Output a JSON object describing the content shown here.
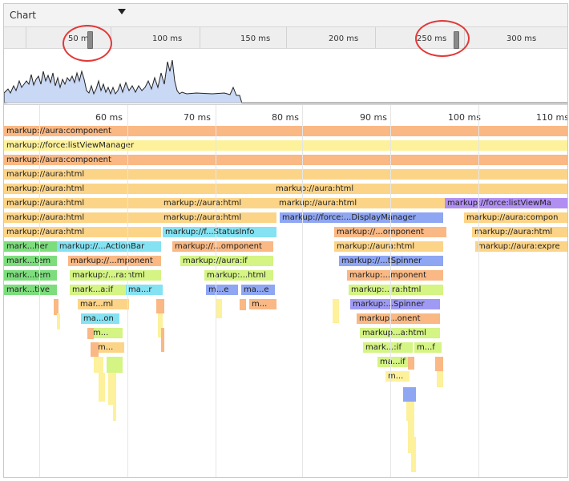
{
  "toolbar": {
    "select_label": "Chart",
    "caret_icon": "caret-down-icon"
  },
  "overview": {
    "ticks": [
      "50 ms",
      "100 ms",
      "150 ms",
      "200 ms",
      "250 ms",
      "300 ms"
    ],
    "left_handle_label": "50 m"
  },
  "main_ruler": {
    "ticks": [
      "60 ms",
      "70 ms",
      "80 ms",
      "90 ms",
      "100 ms",
      "110 ms"
    ]
  },
  "colors": {
    "orange": "#f9b884",
    "yellow": "#fdf19b",
    "gold": "#fcd488",
    "lime": "#d4f484",
    "green": "#7ddd7d",
    "cyan": "#84e2f2",
    "blue": "#8fa6f2",
    "periwinkle": "#9f9af4",
    "purple": "#b18ff2",
    "overview_fill": "#c9d8f4",
    "overview_line": "#222222",
    "annotation": "#e33838"
  },
  "flame": [
    "markup://aura:component",
    "markup://force:listViewManager",
    "markup://aura:component",
    "markup://aura:html",
    "markup://aura:html",
    "markup://aura:html",
    "markup://aura:html",
    "markup://aura:html",
    "markup://aura:html",
    "markup://aura:html",
    "markup://aura:html",
    "markup://aura:html",
    "markup://force:listViewMa",
    "markup://force:...DisplayManager",
    "markup://aura:compon",
    "markup://f...StatusInfo",
    "markup://...omponent",
    "markup://aura:html",
    "markup://aura:html",
    "mark...her",
    "markup://...ActionBar",
    "markup://...omponent",
    "markup://aura:html",
    "markup://aura:expre",
    "mark...tem",
    "markup://...mponent",
    "markup://aura:if",
    "markup://...tSpinner",
    "mark...tem",
    "markup:/...ra:html",
    "markup:...html",
    "markup:...mponent",
    "mark...tive",
    "mark...a:if",
    "ma...r",
    "m...e",
    "ma...e",
    "markup:...ra:html",
    "mar...ml",
    "m...",
    "markup:...Spinner",
    "ma...on",
    "markup...onent",
    "m...",
    "markup...a:html",
    "m...",
    "mark...:if",
    "m...f",
    "ma...if",
    "m..."
  ]
}
